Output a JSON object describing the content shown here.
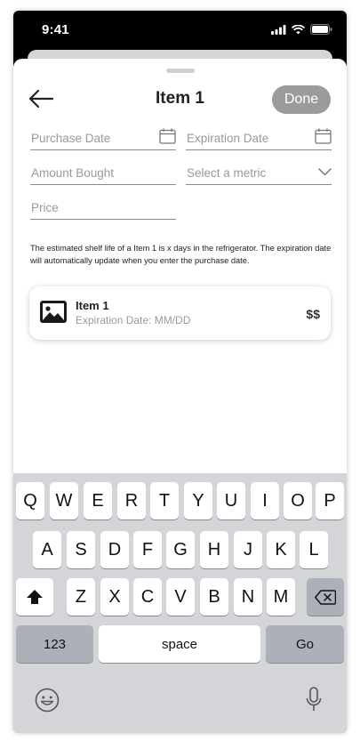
{
  "status_bar": {
    "time": "9:41"
  },
  "header": {
    "title": "Item 1",
    "done_label": "Done"
  },
  "form": {
    "purchase_date": {
      "placeholder": "Purchase Date"
    },
    "expiration_date": {
      "placeholder": "Expiration Date"
    },
    "amount_bought": {
      "placeholder": "Amount Bought"
    },
    "metric": {
      "placeholder": "Select a metric"
    },
    "price": {
      "placeholder": "Price"
    }
  },
  "note": "The estimated shelf life of a Item 1 is x days in the refrigerator. The expiration date will automatically update when you enter the purchase date.",
  "item_card": {
    "name": "Item 1",
    "expiration": "Expiration Date: MM/DD",
    "price": "$$"
  },
  "keyboard": {
    "row1": [
      "Q",
      "W",
      "E",
      "R",
      "T",
      "Y",
      "U",
      "I",
      "O",
      "P"
    ],
    "row2": [
      "A",
      "S",
      "D",
      "F",
      "G",
      "H",
      "J",
      "K",
      "L"
    ],
    "row3": [
      "Z",
      "X",
      "C",
      "V",
      "B",
      "N",
      "M"
    ],
    "numbers_label": "123",
    "space_label": "space",
    "go_label": "Go"
  },
  "colors": {
    "done_button": "#9b9b9b",
    "keyboard_bg": "#d4d5d9",
    "placeholder": "#9a9a9a"
  }
}
